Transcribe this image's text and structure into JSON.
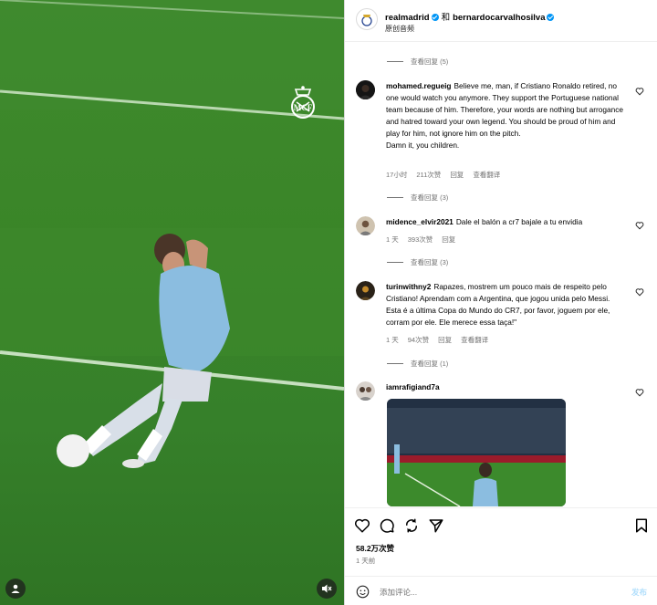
{
  "header": {
    "user1": "realmadrid",
    "and": "和",
    "user2": "bernardocarvalhosilva",
    "subtitle": "原创音频"
  },
  "replies": [
    {
      "label": "查看回复 (5)"
    },
    {
      "label": "查看回复 (3)"
    },
    {
      "label": "查看回复 (3)"
    },
    {
      "label": "查看回复 (1)"
    }
  ],
  "comments": [
    {
      "username": "mohamed.regueig",
      "text": "Believe me, man, if Cristiano Ronaldo retired, no one would watch you anymore. They support the Portuguese national team because of him. Therefore, your words are nothing but arrogance and hatred toward your own legend. You should be proud of him and play for him, not ignore him on the pitch.",
      "text2": "Damn it, you children.",
      "time": "17小时",
      "likes": "211次赞",
      "reply": "回复",
      "translate": "查看翻译"
    },
    {
      "username": "midence_elvir2021",
      "text": "Dale el balón a cr7 bajale a tu envidia",
      "time": "1 天",
      "likes": "393次赞",
      "reply": "回复"
    },
    {
      "username": "turinwithny2",
      "text": "Rapazes, mostrem um pouco mais de respeito pelo Cristiano! Aprendam com a Argentina, que jogou unida pelo Messi. Esta é a última Copa do Mundo do CR7, por favor, joguem por ele, corram por ele. Ele merece essa taça!\"",
      "time": "1 天",
      "likes": "94次赞",
      "reply": "回复",
      "translate": "查看翻译"
    },
    {
      "username": "iamrafigiand7a",
      "text": ""
    }
  ],
  "footer": {
    "likes": "58.2万次赞",
    "date": "1 天前",
    "placeholder": "添加评论...",
    "post": "发布"
  },
  "colors": {
    "pitch": "#3a8528",
    "kit_blue": "#8bbde0",
    "verified": "#0095f6",
    "post_disabled": "#b2dffc"
  },
  "icons": [
    "verified-badge-icon",
    "heart-icon",
    "comment-icon",
    "share-icon",
    "send-icon",
    "bookmark-icon",
    "emoji-icon",
    "muted-audio-icon",
    "user-tag-icon",
    "real-madrid-crest-icon"
  ]
}
